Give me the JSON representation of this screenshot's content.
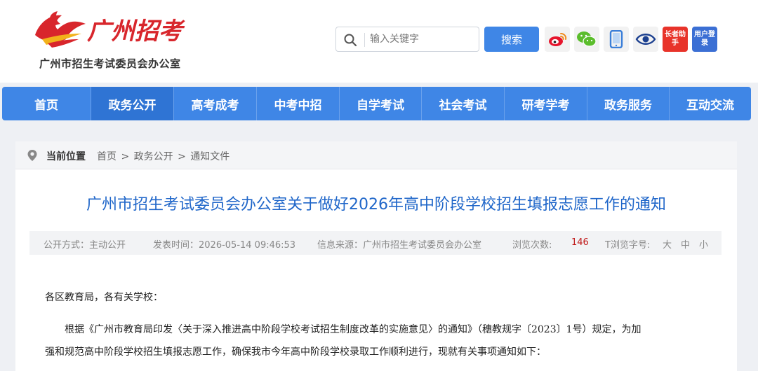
{
  "header": {
    "logo_text": "广州招考",
    "site_name": "广州市招生考试委员会办公室",
    "search_placeholder": "输入关键字",
    "search_button": "搜索",
    "social": [
      {
        "name": "weibo-icon",
        "color": "#e6162d"
      },
      {
        "name": "wechat-icon",
        "color": "#5bbd2c"
      },
      {
        "name": "mobile-icon",
        "color": "#3b7fd9"
      },
      {
        "name": "eye-icon",
        "color": "#1b3f8f"
      }
    ],
    "helper_label": "长者助手",
    "user_login_label": "用户登录"
  },
  "nav": {
    "items": [
      "首页",
      "政务公开",
      "高考成考",
      "中考中招",
      "自学考试",
      "社会考试",
      "研考学考",
      "政务服务",
      "互动交流"
    ],
    "active_index": 1
  },
  "breadcrumb": {
    "label": "当前位置",
    "path": [
      "首页",
      "政务公开",
      "通知文件"
    ],
    "separator": ">"
  },
  "article": {
    "title": "广州市招生考试委员会办公室关于做好2026年高中阶段学校招生填报志愿工作的通知",
    "meta": {
      "disclosure": "公开方式：主动公开",
      "published": "发表时间：2026-05-14 09:46:53",
      "source": "信息来源：广州市招生考试委员会办公室",
      "views_label": "浏览次数:",
      "views_count": "146",
      "font_label": "T浏览字号:",
      "font_sizes": [
        "大",
        "中",
        "小"
      ]
    },
    "greeting": "各区教育局，各有关学校：",
    "paragraph_line1": "根据《广州市教育局印发〈关于深入推进高中阶段学校考试招生制度改革的实施意见〉的通知》（穗教规字〔2023〕1号）规定，为加",
    "paragraph_line2": "强和规范高中阶段学校招生填报志愿工作，确保我市今年高中阶段学校录取工作顺利进行，现就有关事项通知如下："
  },
  "colors": {
    "primary": "#3f86e6",
    "title_blue": "#1f66c9",
    "count_red": "#c01818",
    "logo_red": "#d8262c",
    "logo_yellow": "#f2b21b"
  }
}
